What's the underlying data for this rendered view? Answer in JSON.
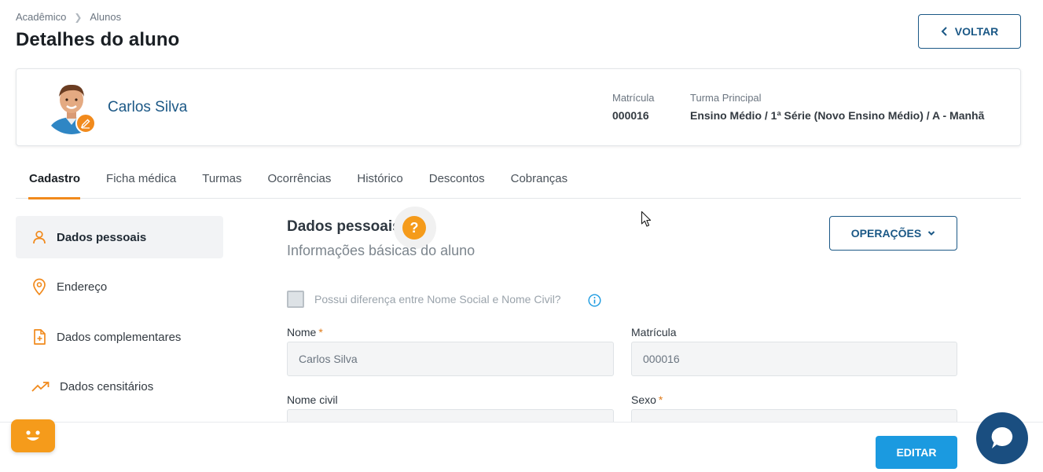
{
  "breadcrumb": {
    "items": [
      "Acadêmico",
      "Alunos"
    ]
  },
  "page": {
    "title": "Detalhes do aluno",
    "back_label": "VOLTAR"
  },
  "student": {
    "name": "Carlos Silva",
    "matricula_label": "Matrícula",
    "matricula_value": "000016",
    "turma_label": "Turma Principal",
    "turma_value": "Ensino Médio / 1ª Série (Novo Ensino Médio) / A - Manhã"
  },
  "tabs": [
    {
      "label": "Cadastro",
      "active": true
    },
    {
      "label": "Ficha médica"
    },
    {
      "label": "Turmas"
    },
    {
      "label": "Ocorrências"
    },
    {
      "label": "Histórico"
    },
    {
      "label": "Descontos"
    },
    {
      "label": "Cobranças"
    }
  ],
  "sidebar": {
    "items": [
      {
        "label": "Dados pessoais",
        "icon": "user-icon",
        "active": true
      },
      {
        "label": "Endereço",
        "icon": "location-pin-icon"
      },
      {
        "label": "Dados complementares",
        "icon": "document-plus-icon"
      },
      {
        "label": "Dados censitários",
        "icon": "trending-up-icon"
      }
    ]
  },
  "section": {
    "title": "Dados pessoais",
    "help": "?",
    "subtitle": "Informações básicas do aluno",
    "operations_label": "OPERAÇÕES"
  },
  "form": {
    "social_name_checkbox": "Possui diferença entre Nome Social e Nome Civil?",
    "nome_label": "Nome",
    "nome_value": "Carlos Silva",
    "matricula_label": "Matrícula",
    "matricula_value": "000016",
    "nome_civil_label": "Nome civil",
    "sexo_label": "Sexo",
    "required_mark": "*"
  },
  "footer": {
    "edit_label": "EDITAR"
  },
  "colors": {
    "primary": "#1b5886",
    "accent": "#f18a1c",
    "button_blue": "#1b9ae0",
    "chat": "#1a4e80"
  }
}
